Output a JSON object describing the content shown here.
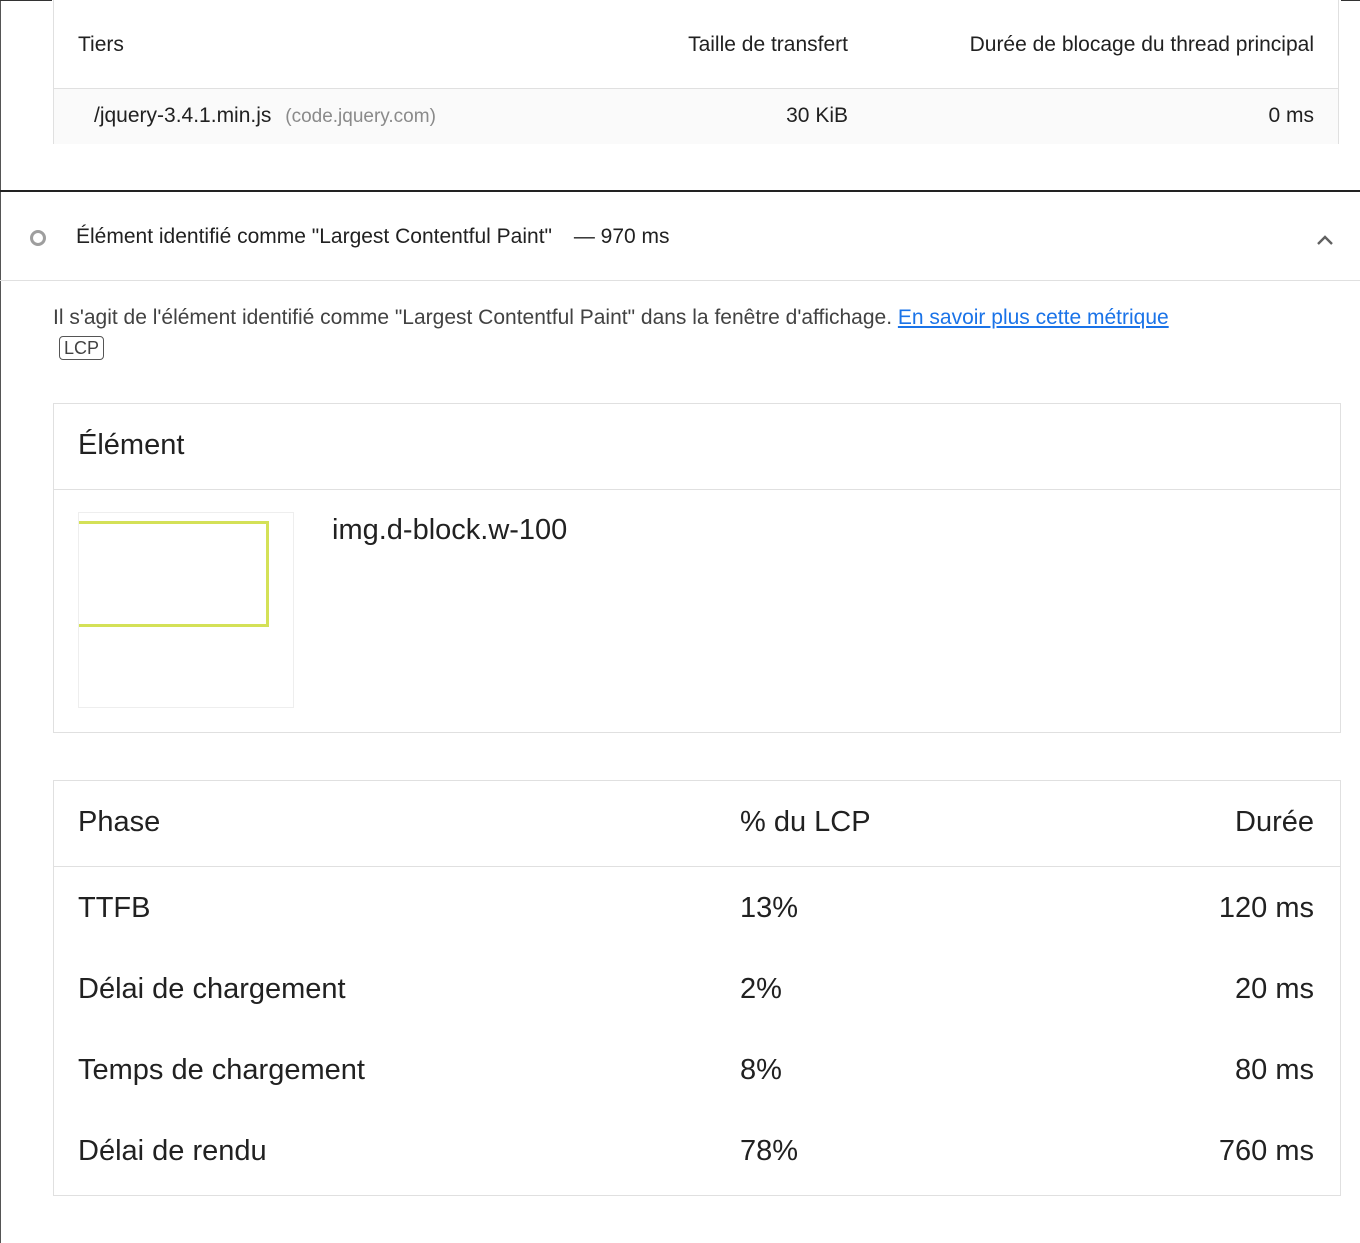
{
  "thirdParty": {
    "headers": {
      "tier": "Tiers",
      "transferSize": "Taille de transfert",
      "mainThreadBlocking": "Durée de blocage du thread principal"
    },
    "rows": [
      {
        "url": "/jquery-3.4.1.min.js",
        "host": "(code.jquery.com)",
        "transferSize": "30 KiB",
        "blockingTime": "0 ms"
      }
    ]
  },
  "audit": {
    "title": "Élément identifié comme \"Largest Contentful Paint\"",
    "displayValue": "— 970 ms",
    "description": "Il s'agit de l'élément identifié comme \"Largest Contentful Paint\" dans la fenêtre d'affichage.",
    "learnMoreLink": "En savoir plus cette métrique",
    "badge": "LCP"
  },
  "elementTable": {
    "header": "Élément",
    "selector": "img.d-block.w-100"
  },
  "phaseTable": {
    "headers": {
      "phase": "Phase",
      "percent": "% du LCP",
      "duration": "Durée"
    },
    "rows": [
      {
        "phase": "TTFB",
        "percent": "13%",
        "duration": "120 ms"
      },
      {
        "phase": "Délai de chargement",
        "percent": "2%",
        "duration": "20 ms"
      },
      {
        "phase": "Temps de chargement",
        "percent": "8%",
        "duration": "80 ms"
      },
      {
        "phase": "Délai de rendu",
        "percent": "78%",
        "duration": "760 ms"
      }
    ]
  },
  "colors": {
    "link": "#1a73e8",
    "highlight": "#d4e157",
    "neutralIcon": "#9e9e9e"
  },
  "icons": {
    "auditStatus": "circle-icon",
    "collapse": "chevron-up-icon"
  }
}
